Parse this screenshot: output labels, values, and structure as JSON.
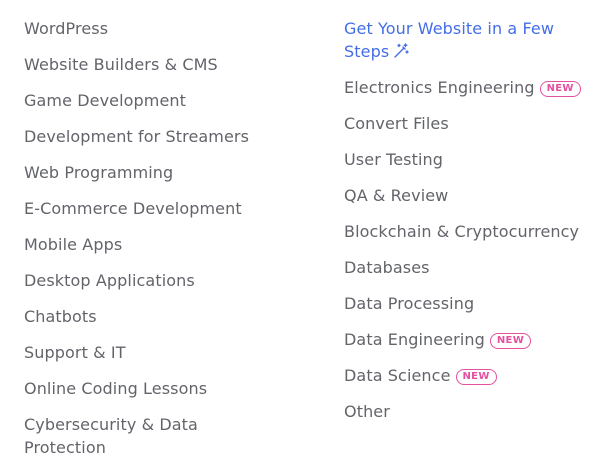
{
  "left_column": [
    "WordPress",
    "Website Builders & CMS",
    "Game Development",
    "Development for Streamers",
    "Web Programming",
    "E-Commerce Development",
    "Mobile Apps",
    "Desktop Applications",
    "Chatbots",
    "Support & IT",
    "Online Coding Lessons",
    "Cybersecurity & Data Protection"
  ],
  "right_column": {
    "promo": {
      "label": "Get Your Website in a Few Steps",
      "icon": "magic-wand-icon",
      "color": "#446ee7"
    },
    "items": [
      {
        "label": "Electronics Engineering",
        "badge": "NEW"
      },
      {
        "label": "Convert Files"
      },
      {
        "label": "User Testing"
      },
      {
        "label": "QA & Review"
      },
      {
        "label": "Blockchain & Cryptocurrency"
      },
      {
        "label": "Databases"
      },
      {
        "label": "Data Processing"
      },
      {
        "label": "Data Engineering",
        "badge": "NEW"
      },
      {
        "label": "Data Science",
        "badge": "NEW"
      },
      {
        "label": "Other"
      }
    ]
  },
  "colors": {
    "text": "#62646a",
    "link": "#446ee7",
    "badge": "#e5509f"
  }
}
